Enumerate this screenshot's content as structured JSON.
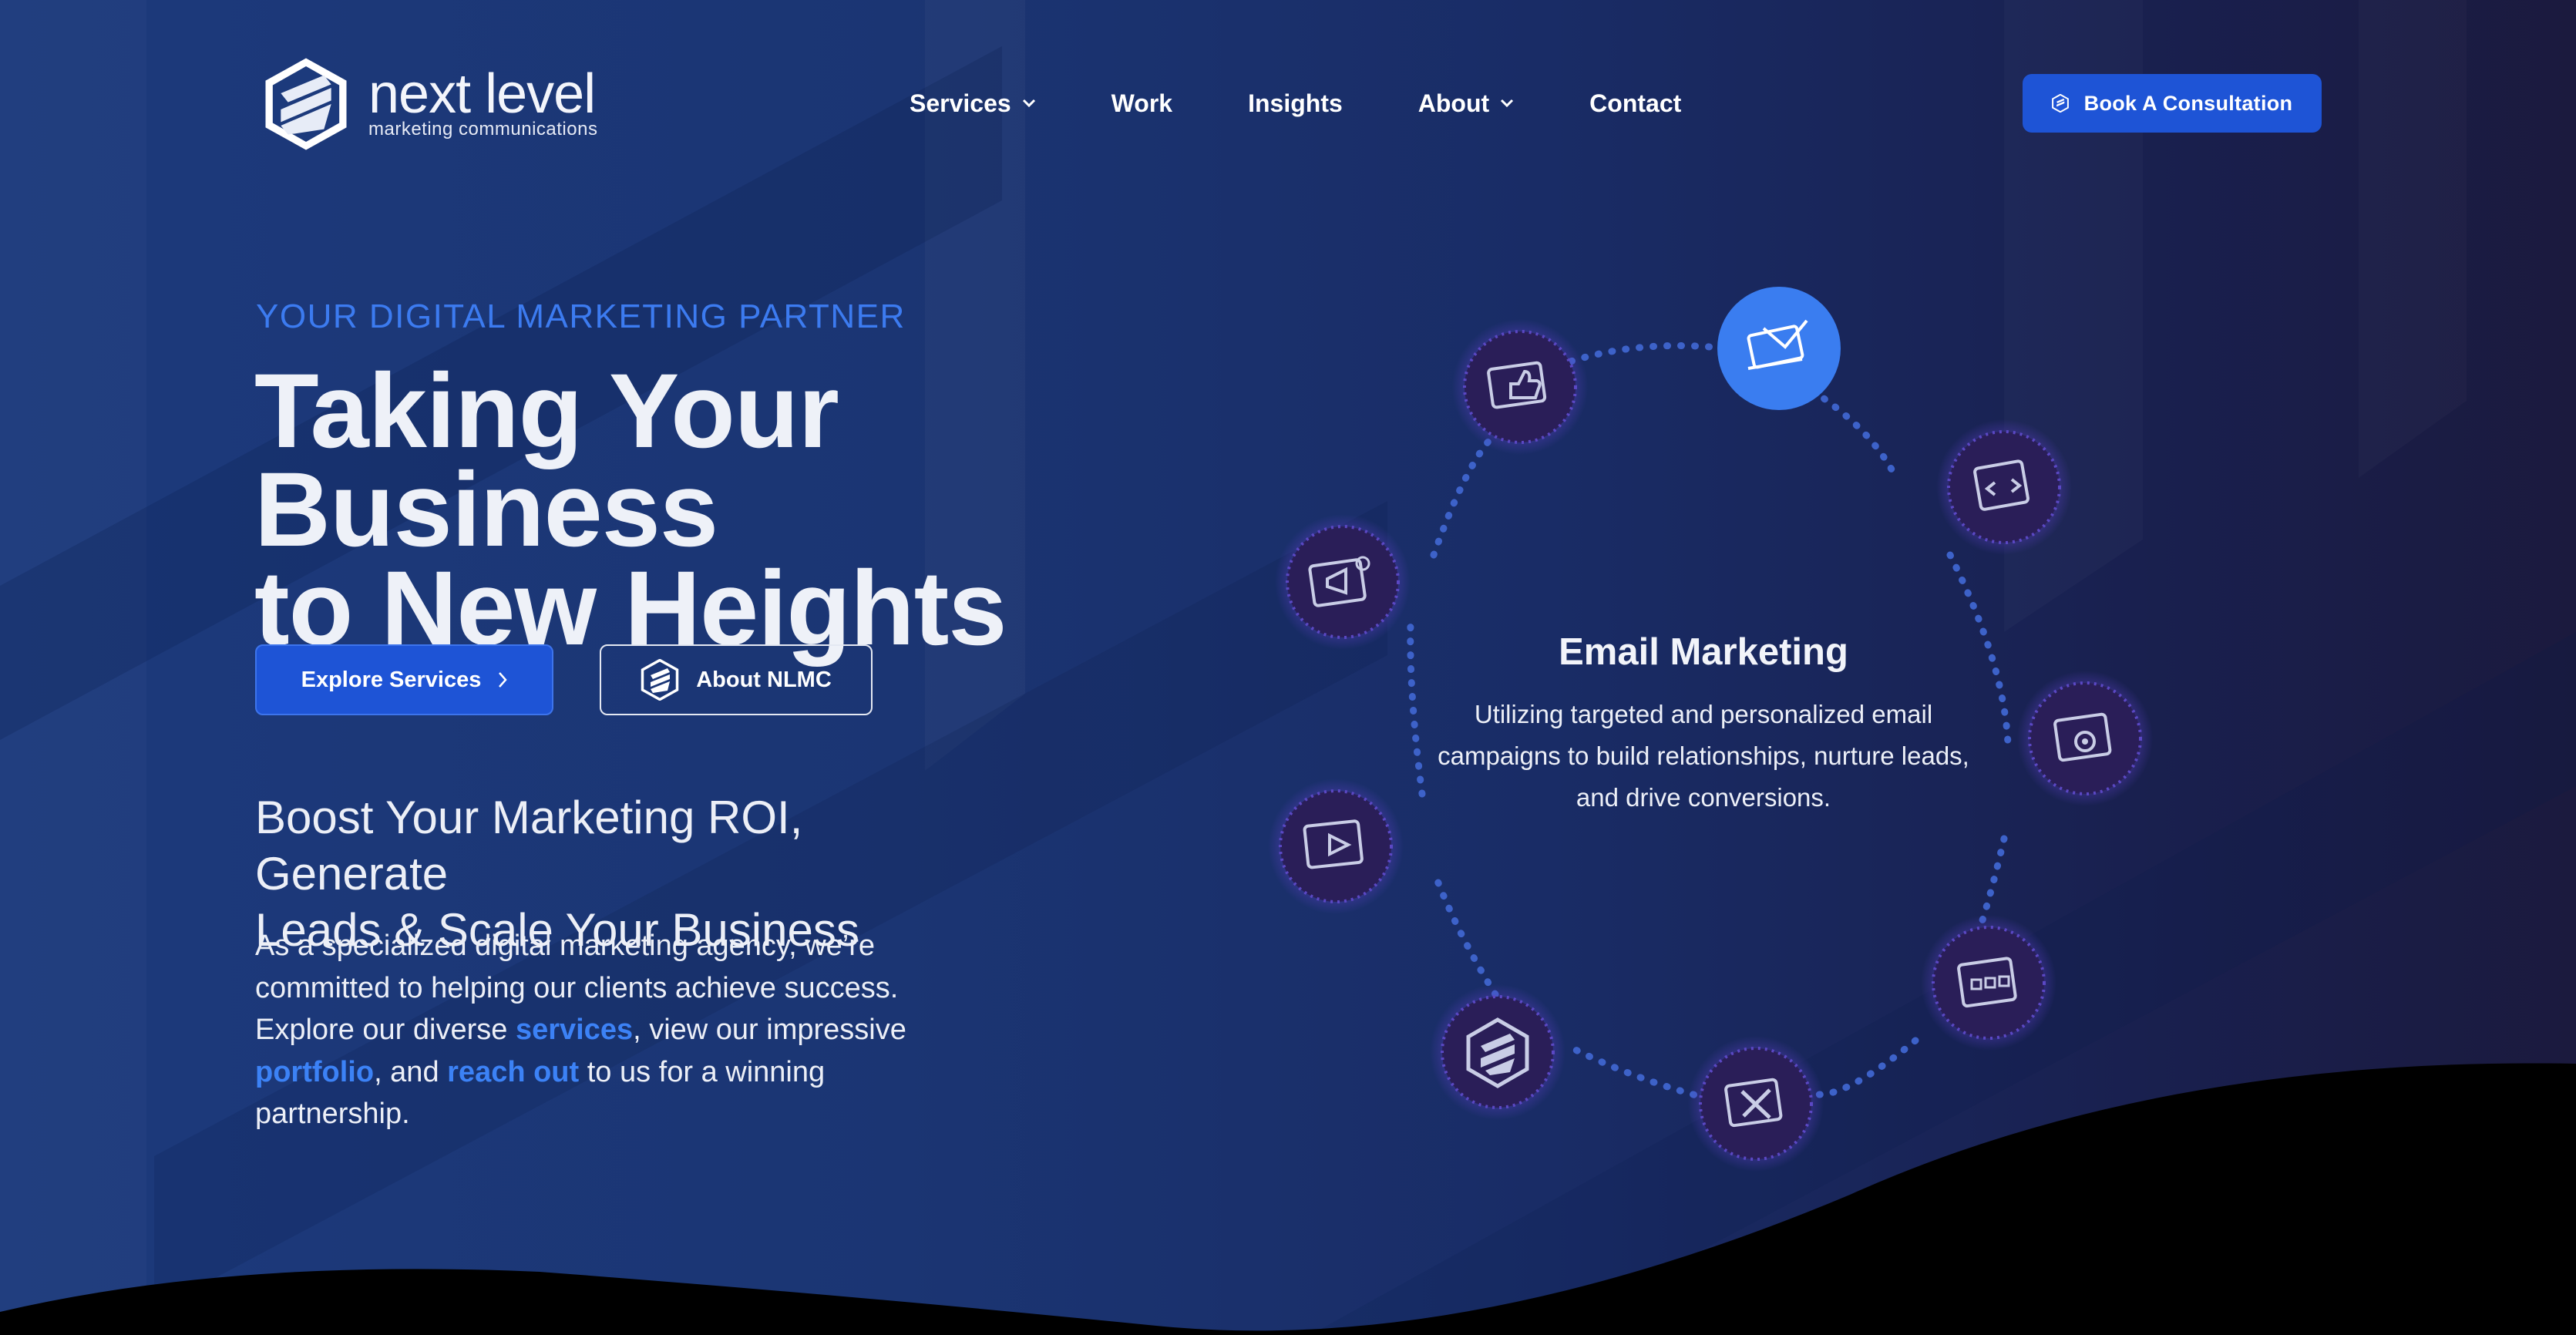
{
  "colors": {
    "accent": "#1e54d6",
    "accent_light": "#3c7bf0",
    "link": "#3c82f6",
    "background_start": "#1c3a7c",
    "background_end": "#1b1a3e",
    "orbit_node": "#2a1e58",
    "orbit_active": "#3a7df0"
  },
  "brand": {
    "name": "next level",
    "tagline": "marketing communications",
    "logo_icon": "hexagon-stripes-logo"
  },
  "nav": {
    "items": [
      {
        "label": "Services",
        "has_dropdown": true
      },
      {
        "label": "Work",
        "has_dropdown": false
      },
      {
        "label": "Insights",
        "has_dropdown": false
      },
      {
        "label": "About",
        "has_dropdown": true
      },
      {
        "label": "Contact",
        "has_dropdown": false
      }
    ],
    "cta_label": "Book A Consultation"
  },
  "hero": {
    "eyebrow": "YOUR DIGITAL MARKETING PARTNER",
    "headline_line1": "Taking Your Business",
    "headline_line2": "to New Heights",
    "primary_button": "Explore Services",
    "secondary_button": "About NLMC",
    "subhead_line1": "Boost Your Marketing ROI, Generate",
    "subhead_line2": "Leads & Scale Your Business",
    "paragraph": {
      "part1": "As a specialized digital marketing agency, we’re committed to helping our clients achieve success. Explore our diverse ",
      "link1": "services",
      "part2": ", view our impressive ",
      "link2": "portfolio",
      "part3": ", and ",
      "link3": "reach out",
      "part4": " to us for a winning partnership."
    }
  },
  "services_wheel": {
    "active_title": "Email Marketing",
    "active_description": "Utilizing targeted and personalized email campaigns to build relationships, nurture leads, and drive conversions.",
    "icons": [
      {
        "name": "email-marketing-icon",
        "active": true
      },
      {
        "name": "web-development-icon",
        "active": false
      },
      {
        "name": "website-settings-icon",
        "active": false
      },
      {
        "name": "web-design-icon",
        "active": false
      },
      {
        "name": "graphic-design-icon",
        "active": false
      },
      {
        "name": "brand-logo-icon",
        "active": false
      },
      {
        "name": "video-marketing-icon",
        "active": false
      },
      {
        "name": "advertising-icon",
        "active": false
      },
      {
        "name": "social-media-icon",
        "active": false
      }
    ]
  }
}
